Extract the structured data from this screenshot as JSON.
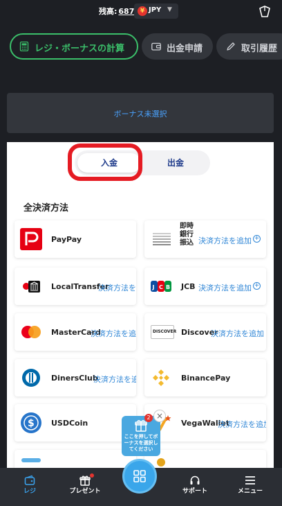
{
  "topbar": {
    "balance_label": "残高:",
    "balance_value": "687",
    "currency": "JPY",
    "currency_symbol": "¥"
  },
  "tabs": [
    {
      "label": "レジ・ボーナスの計算",
      "icon": "calculator-icon",
      "active": true
    },
    {
      "label": "出金申請",
      "icon": "wallet-icon",
      "active": false
    },
    {
      "label": "取引履歴",
      "icon": "pen-icon",
      "active": false
    }
  ],
  "bonus": {
    "text": "ボーナス未選択"
  },
  "deposit_toggle": {
    "deposit": "入金",
    "withdraw": "出金"
  },
  "section_title": "全決済方法",
  "methods": {
    "paypay": {
      "name": "PayPay",
      "icon": "paypay-icon"
    },
    "bank": {
      "name": "即時\n銀行\n振込",
      "add": "決済方法を追加",
      "icon": "bank-transfer-icon"
    },
    "localtransfer": {
      "name": "LocalTransfer",
      "add": "決済方法を追加",
      "icon": "local-transfer-icon"
    },
    "jcb": {
      "name": "JCB",
      "add": "決済方法を追加",
      "icon": "jcb-icon"
    },
    "mastercard": {
      "name": "MasterCard",
      "add": "決済方法を追加",
      "icon": "mastercard-icon"
    },
    "discover": {
      "name": "Discover",
      "add": "決済方法を追加",
      "icon": "discover-icon",
      "logo_text": "DISCOVER"
    },
    "dinersclub": {
      "name": "DinersClub",
      "add": "決済方法を追加",
      "icon": "diners-club-icon"
    },
    "binancepay": {
      "name": "BinancePay",
      "icon": "binance-icon"
    },
    "usdcoin": {
      "name": "USDCoin",
      "icon": "usdcoin-icon"
    },
    "vegawallet": {
      "name": "VegaWallet",
      "add": "決済方法を追加",
      "icon": "vega-wallet-icon"
    }
  },
  "promo": {
    "text": "ここを押してボーナスを選択してください",
    "badge": "2"
  },
  "nav": [
    {
      "label": "レジ",
      "icon": "register-icon",
      "active": true
    },
    {
      "label": "プレゼント",
      "icon": "gift-icon",
      "active": false
    },
    {
      "label": "サポート",
      "icon": "headset-icon",
      "active": false
    },
    {
      "label": "メニュー",
      "icon": "menu-icon",
      "active": false
    }
  ],
  "colors": {
    "accent_green": "#3bbf6a",
    "link_blue": "#2f86d6",
    "highlight_red": "#e51b23",
    "nav_active": "#3a9fe8"
  }
}
